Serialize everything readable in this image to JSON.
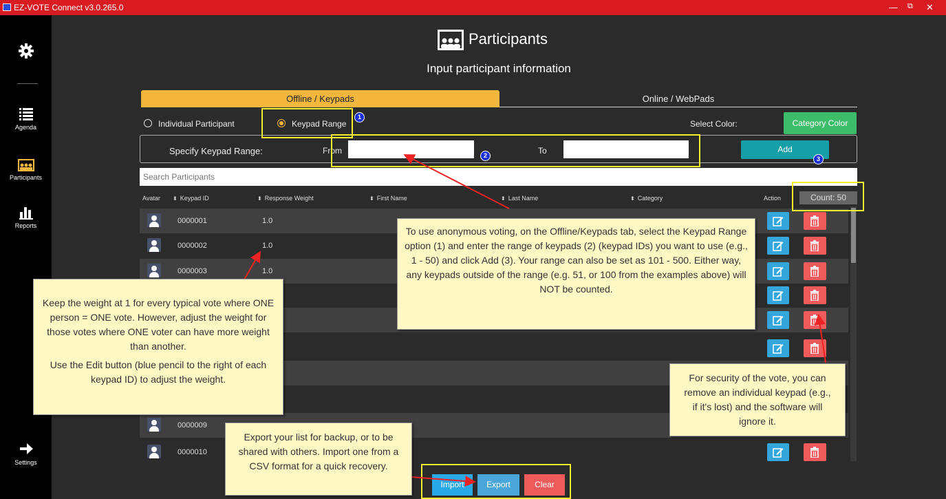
{
  "window": {
    "title": "EZ-VOTE Connect v3.0.265.0",
    "minimize": "—",
    "restore": "⧉",
    "close": "✕"
  },
  "sidebar": {
    "items": [
      {
        "label": "Agenda",
        "icon": "list-icon"
      },
      {
        "label": "Participants",
        "icon": "participants-icon"
      },
      {
        "label": "Reports",
        "icon": "bar-chart-icon"
      },
      {
        "label": "Settings",
        "icon": "arrow-right-icon"
      }
    ]
  },
  "header": {
    "title": "Participants",
    "subtitle": "Input participant information"
  },
  "tabs": [
    {
      "label": "Offline / Keypads",
      "active": true
    },
    {
      "label": "Online / WebPads",
      "active": false
    }
  ],
  "mode": {
    "individual": "Individual Participant",
    "range": "Keypad Range",
    "selected": "range"
  },
  "color": {
    "label": "Select Color:",
    "button": "Category Color"
  },
  "range": {
    "label": "Specify Keypad Range:",
    "from_label": "From",
    "to_label": "To",
    "from_value": "",
    "to_value": "",
    "add_label": "Add"
  },
  "search": {
    "placeholder": "Search Participants"
  },
  "table": {
    "columns": {
      "avatar": "Avatar",
      "keypad_id": "Keypad ID",
      "weight": "Response Weight",
      "first_name": "First Name",
      "last_name": "Last Name",
      "category": "Category",
      "action": "Action"
    },
    "count_text": "Count: 50",
    "rows": [
      {
        "keypad_id": "0000001",
        "weight": "1.0"
      },
      {
        "keypad_id": "0000002",
        "weight": "1.0"
      },
      {
        "keypad_id": "0000003",
        "weight": "1.0"
      },
      {
        "keypad_id": "",
        "weight": ""
      },
      {
        "keypad_id": "",
        "weight": ""
      },
      {
        "keypad_id": "",
        "weight": ""
      },
      {
        "keypad_id": "",
        "weight": ""
      },
      {
        "keypad_id": "",
        "weight": ""
      },
      {
        "keypad_id": "0000009",
        "weight": ""
      },
      {
        "keypad_id": "0000010",
        "weight": ""
      }
    ]
  },
  "footer": {
    "import": "Import",
    "export": "Export",
    "clear": "Clear"
  },
  "annotations": {
    "badges": [
      "1",
      "2",
      "3"
    ],
    "anonymous": "To use anonymous voting, on the Offline/Keypads tab, select the Keypad Range option (1) and enter the range of keypads (2) (keypad IDs) you want to use (e.g., 1 - 50) and click Add (3). Your range can also be set as 101 - 500. Either way, any keypads outside of the range (e.g. 51, or 100 from the examples above) will NOT be counted.",
    "weight_1": "Keep the weight at 1 for every typical vote where ONE person = ONE vote. However, adjust the weight for those votes where ONE voter can have more weight than another.",
    "weight_2": "Use the Edit button (blue pencil to the right of each keypad ID) to adjust the weight.",
    "security": "For security of the vote, you can remove an individual keypad (e.g., if it's lost) and the software will ignore it.",
    "export": "Export your list for backup, or to be shared with others. Import one from a CSV format for a quick recovery."
  },
  "colors": {
    "titlebar": "#d81c21",
    "tab_active": "#f3b73d",
    "green": "#3dbc6a",
    "teal": "#149fa8",
    "edit": "#33a6dc",
    "delete": "#ef5a5a",
    "callout": "#fef9c4",
    "highlight": "#f7ef2b"
  }
}
